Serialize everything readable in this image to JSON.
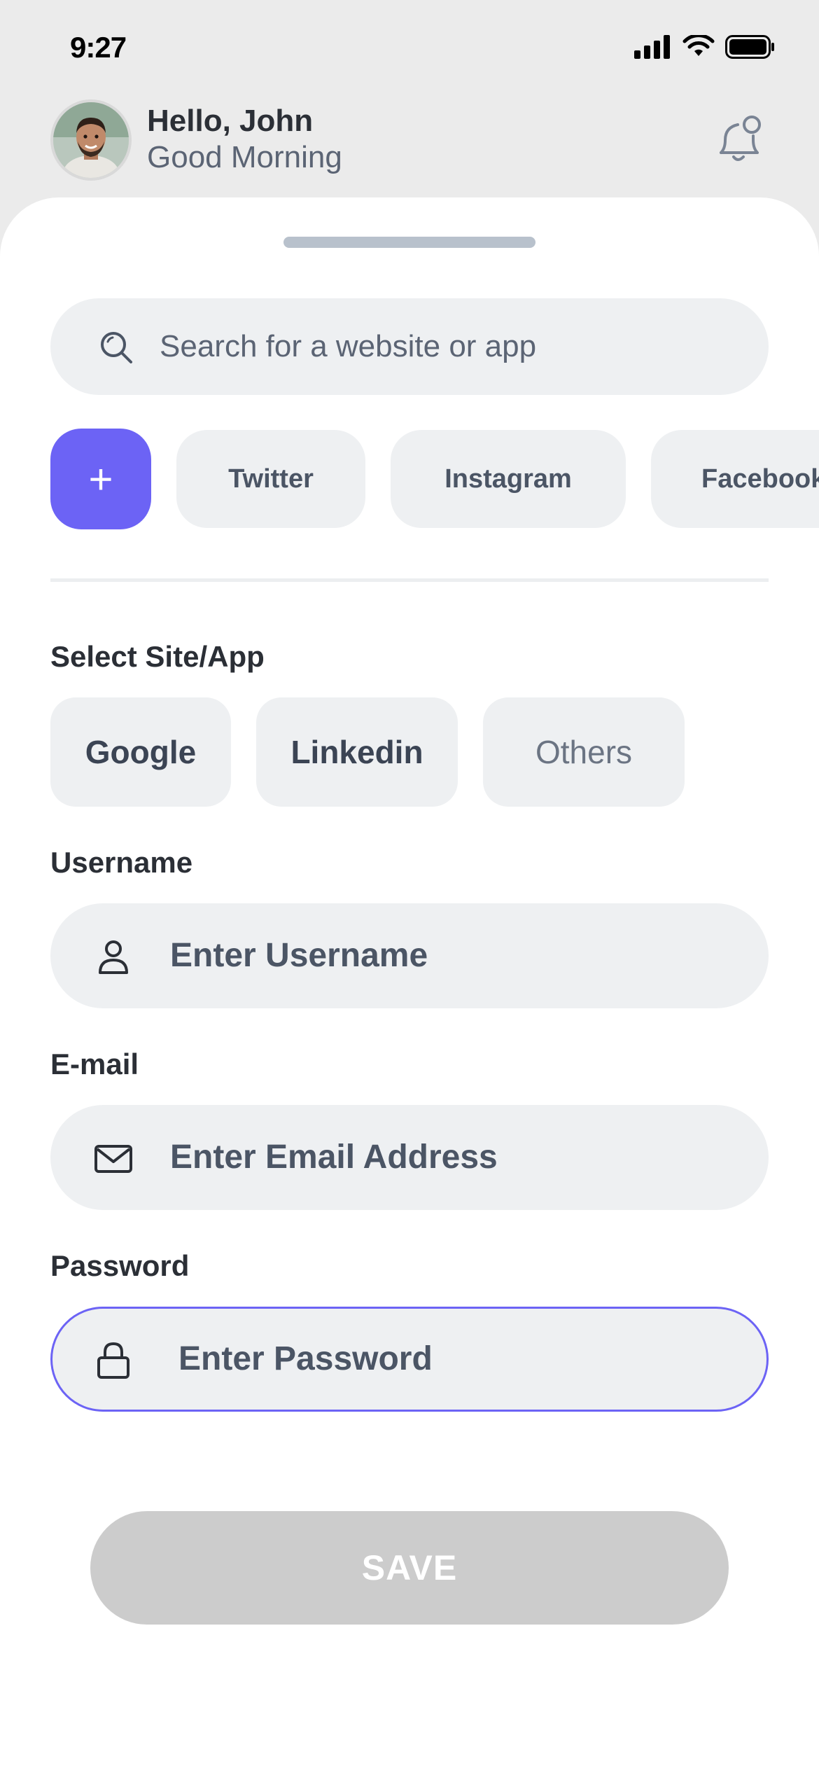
{
  "status_bar": {
    "time": "9:27"
  },
  "header": {
    "greeting": "Hello, John",
    "subgreeting": "Good Morning",
    "avatar_icon": "user-avatar-icon",
    "notification_icon": "bell-icon"
  },
  "search": {
    "placeholder": "Search for a website or app",
    "icon": "search-icon"
  },
  "quick_chips": {
    "add_label": "+",
    "items": [
      "Twitter",
      "Instagram",
      "Facebook"
    ]
  },
  "site_select": {
    "label": "Select Site/App",
    "options": [
      "Google",
      "Linkedin",
      "Others"
    ]
  },
  "form": {
    "username": {
      "label": "Username",
      "placeholder": "Enter Username",
      "icon": "user-icon"
    },
    "email": {
      "label": "E-mail",
      "placeholder": "Enter Email Address",
      "icon": "mail-icon"
    },
    "password": {
      "label": "Password",
      "placeholder": "Enter Password",
      "icon": "lock-icon"
    }
  },
  "save_label": "SAVE",
  "colors": {
    "accent": "#6c63f5",
    "field_bg": "#eef0f2",
    "disabled_button": "#cccccc",
    "background": "#ebebeb"
  }
}
